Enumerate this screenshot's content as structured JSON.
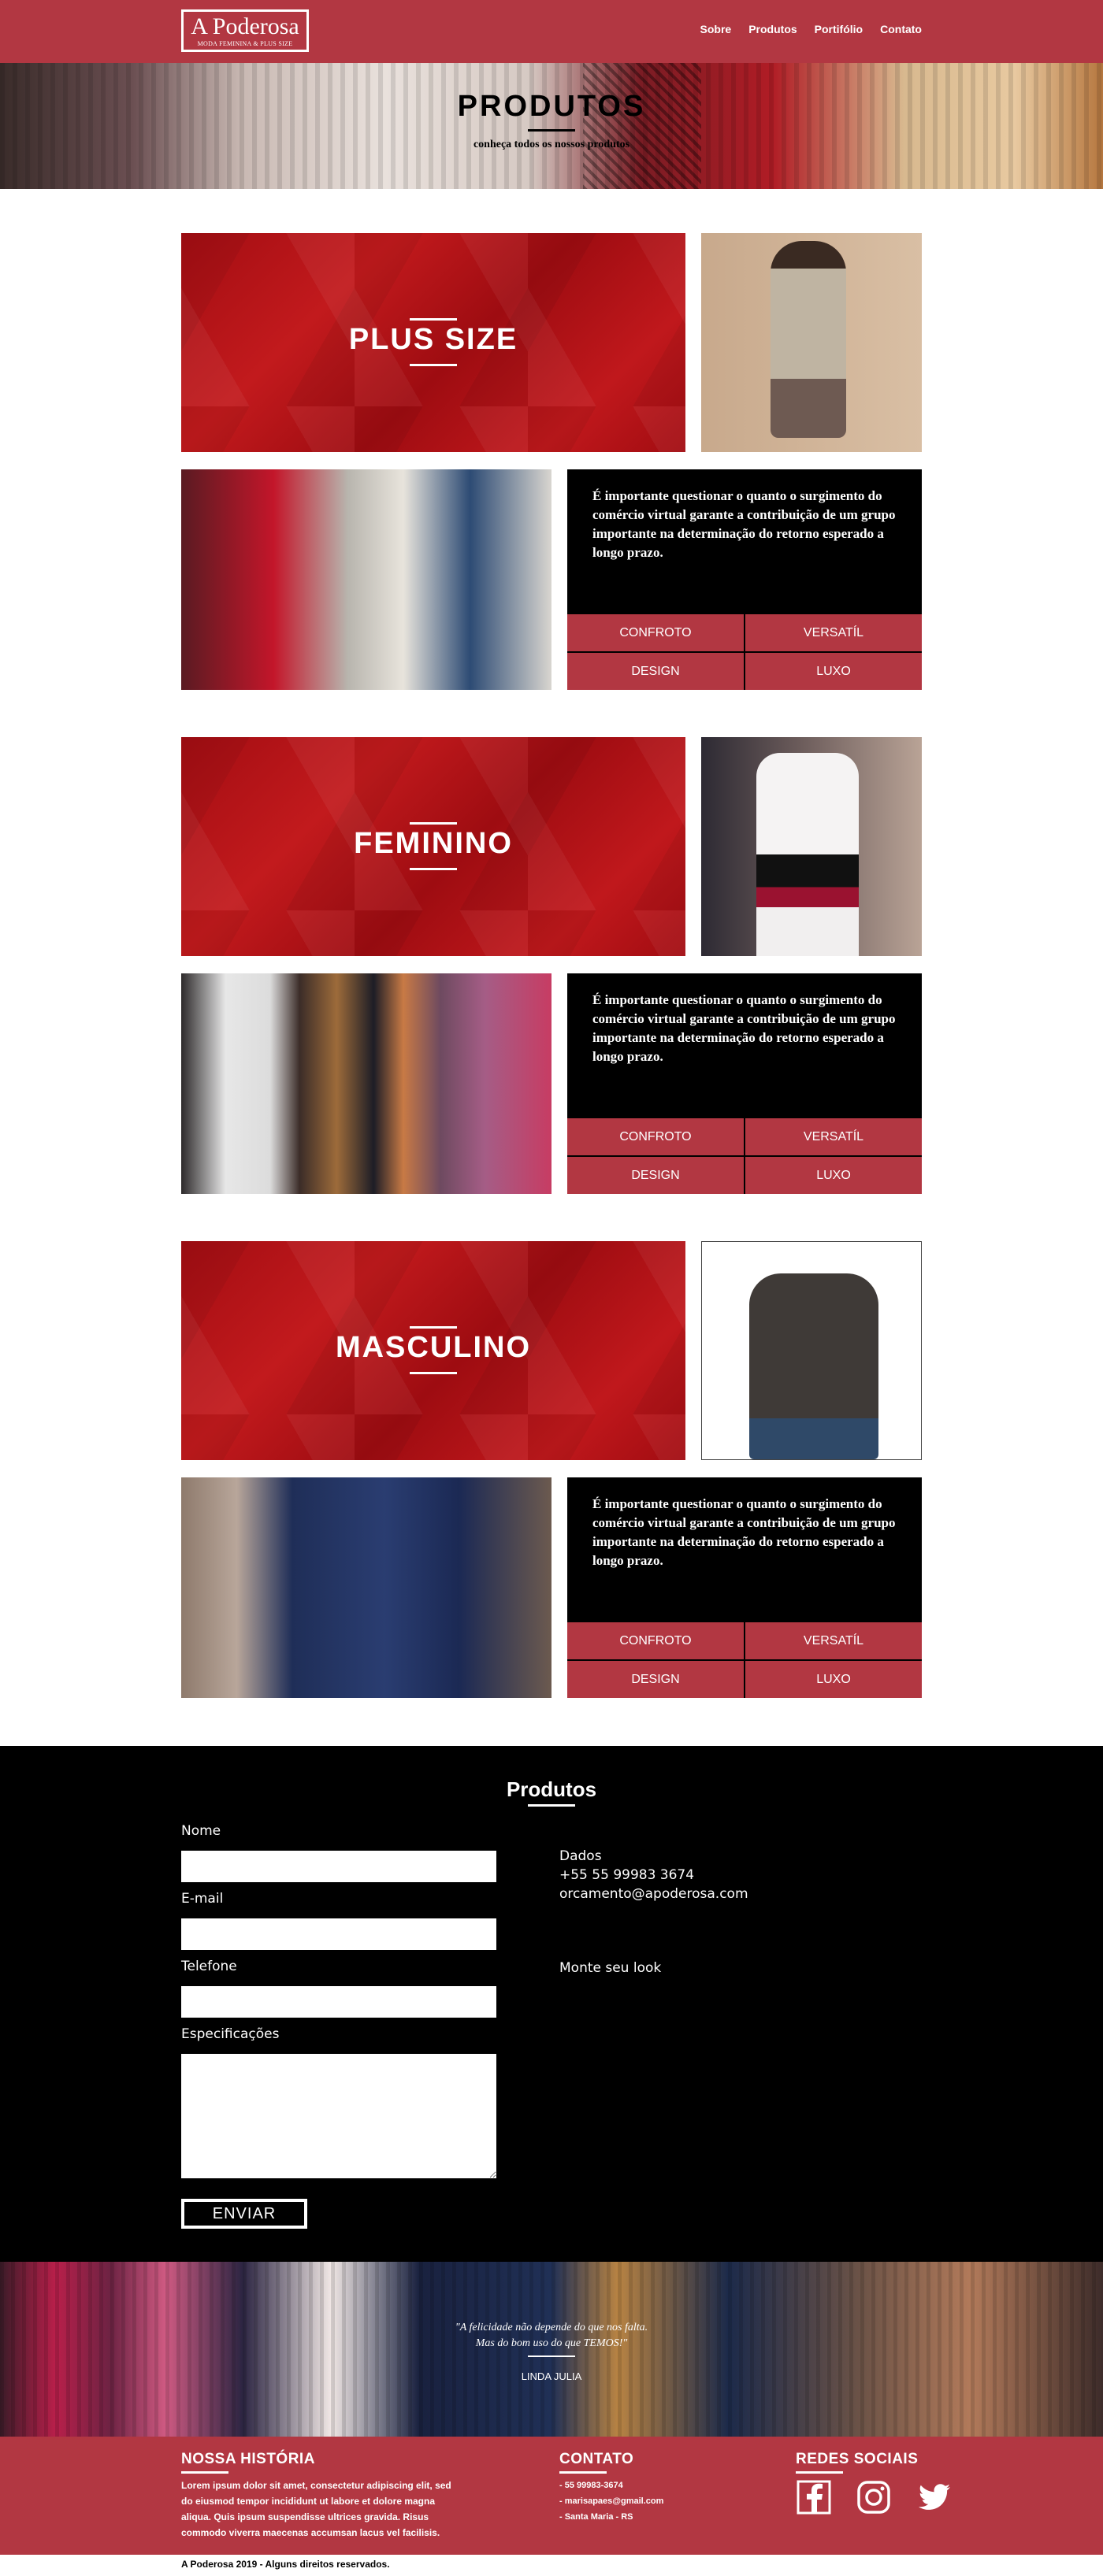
{
  "header": {
    "logo_title": "A Poderosa",
    "logo_subtitle": "MODA FEMININA & PLUS SIZE",
    "nav": [
      "Sobre",
      "Produtos",
      "Portifólio",
      "Contato"
    ]
  },
  "hero": {
    "title": "PRODUTOS",
    "subtitle": "conheça todos os nossos produtos"
  },
  "categories": [
    {
      "title": "PLUS SIZE",
      "text": "É importante questionar o quanto o surgimento do comércio virtual garante a contribuição de um grupo importante na determinação do retorno esperado a longo prazo.",
      "tags": [
        "CONFROTO",
        "VERSATÍL",
        "DESIGN",
        "LUXO"
      ]
    },
    {
      "title": "FEMININO",
      "text": "É importante questionar o quanto o surgimento do comércio virtual garante a contribuição de um grupo importante na determinação do retorno esperado a longo prazo.",
      "tags": [
        "CONFROTO",
        "VERSATÍL",
        "DESIGN",
        "LUXO"
      ]
    },
    {
      "title": "MASCULINO",
      "text": "É importante questionar o quanto o surgimento do comércio virtual garante a contribuição de um grupo importante na determinação do retorno esperado a longo prazo.",
      "tags": [
        "CONFROTO",
        "VERSATÍL",
        "DESIGN",
        "LUXO"
      ]
    }
  ],
  "contact": {
    "title": "Produtos",
    "fields": {
      "name_label": "Nome",
      "email_label": "E-mail",
      "phone_label": "Telefone",
      "specs_label": "Especificações",
      "name_value": "",
      "email_value": "",
      "phone_value": "",
      "specs_value": ""
    },
    "send_label": "ENVIAR",
    "dados_title": "Dados",
    "phone": "+55 55 99983 3674",
    "email": "orcamento@apoderosa.com",
    "look_title": "Monte seu look"
  },
  "quote": {
    "line1": "\"A felicidade não depende do que nos falta.",
    "line2": "Mas do bom uso do que TEMOS!\"",
    "author": "LINDA JULIA"
  },
  "footer": {
    "history_title": "NOSSA HISTÓRIA",
    "history_text": "Lorem ipsum dolor sit amet, consectetur adipiscing elit, sed do eiusmod tempor incididunt ut labore et dolore magna aliqua. Quis ipsum suspendisse ultrices gravida. Risus commodo viverra maecenas accumsan lacus vel facilisis.",
    "contact_title": "CONTATO",
    "contact_lines": [
      "- 55 99983-3674",
      "- marisapaes@gmail.com",
      "- Santa Maria - RS"
    ],
    "social_title": "REDES SOCIAIS",
    "social_icons": [
      "facebook-icon",
      "instagram-icon",
      "twitter-icon"
    ],
    "copyright": "A Poderosa 2019 - Alguns direitos reservados."
  },
  "colors": {
    "brand": "#b23742",
    "banner_red": "#b5141a",
    "dark": "#000000"
  }
}
